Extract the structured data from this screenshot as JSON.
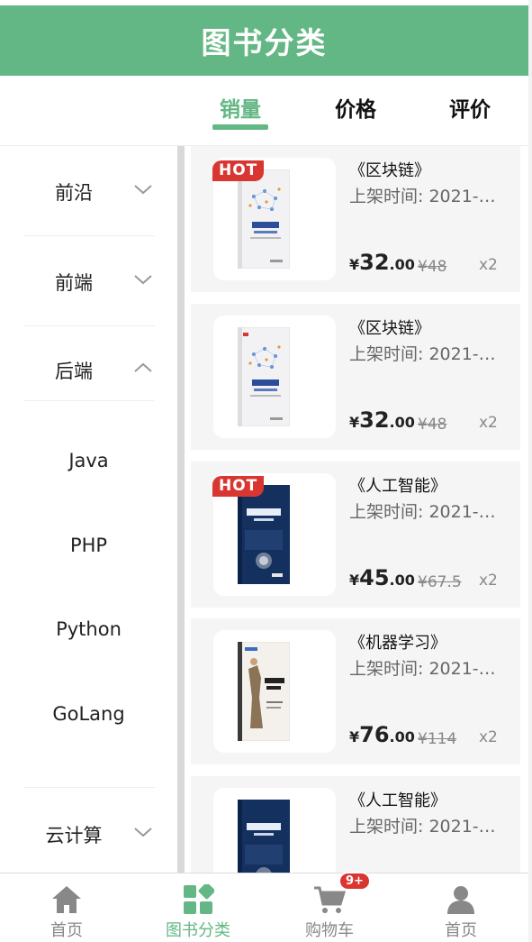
{
  "header": {
    "title": "图书分类"
  },
  "sort_tabs": [
    {
      "label": "销量",
      "active": true
    },
    {
      "label": "价格",
      "active": false
    },
    {
      "label": "评价",
      "active": false
    }
  ],
  "sidebar": {
    "categories": [
      {
        "label": "前沿",
        "expanded": false
      },
      {
        "label": "前端",
        "expanded": false
      },
      {
        "label": "后端",
        "expanded": true,
        "children": [
          "Java",
          "PHP",
          "Python",
          "GoLang"
        ]
      },
      {
        "label": "云计算",
        "expanded": false
      }
    ]
  },
  "books": [
    {
      "title": "《区块链》",
      "date": "上架时间: 2021-0...",
      "yen": "¥",
      "price_int": "32",
      "price_dec": ".00",
      "old_price": "¥48",
      "qty": "x2",
      "hot": true,
      "hot_label": "HOT",
      "cover": "blockchain"
    },
    {
      "title": "《区块链》",
      "date": "上架时间: 2021-0...",
      "yen": "¥",
      "price_int": "32",
      "price_dec": ".00",
      "old_price": "¥48",
      "qty": "x2",
      "hot": false,
      "cover": "blockchain"
    },
    {
      "title": "《人工智能》",
      "date": "上架时间: 2021-0...",
      "yen": "¥",
      "price_int": "45",
      "price_dec": ".00",
      "old_price": "¥67.5",
      "qty": "x2",
      "hot": true,
      "hot_label": "HOT",
      "cover": "ai"
    },
    {
      "title": "《机器学习》",
      "date": "上架时间: 2021-0...",
      "yen": "¥",
      "price_int": "76",
      "price_dec": ".00",
      "old_price": "¥114",
      "qty": "x2",
      "hot": false,
      "cover": "ml"
    },
    {
      "title": "《人工智能》",
      "date": "上架时间: 2021-0...",
      "hot": false,
      "cover": "ai"
    }
  ],
  "tabbar": {
    "items": [
      {
        "label": "首页",
        "icon": "home-icon",
        "active": false
      },
      {
        "label": "图书分类",
        "icon": "category-icon",
        "active": true
      },
      {
        "label": "购物车",
        "icon": "cart-icon",
        "active": false,
        "badge": "9+"
      },
      {
        "label": "首页",
        "icon": "user-icon",
        "active": false
      }
    ]
  },
  "colors": {
    "primary": "#63b784",
    "hot": "#d93632",
    "card_bg": "#f5f5f5",
    "icon_gray": "#888888"
  }
}
